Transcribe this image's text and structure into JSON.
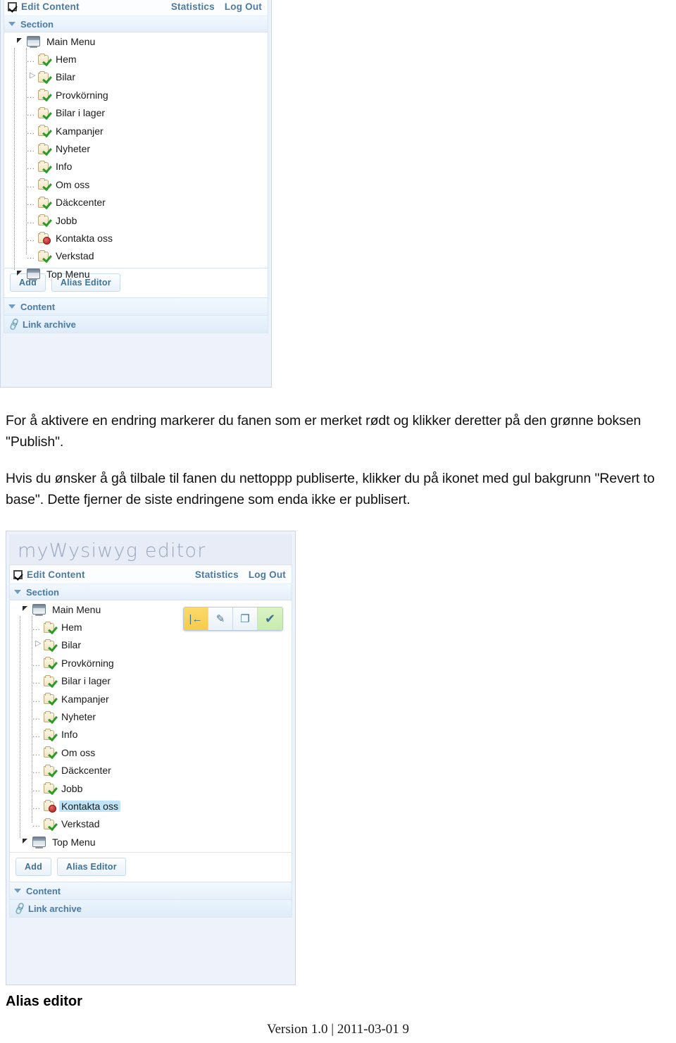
{
  "document": {
    "alias_heading": "Alias editor",
    "footer": "Version 1.0 | 2011-03-01 9"
  },
  "paragraphs": {
    "p1": "For å aktivere en endring markerer du fanen som er merket rødt og klikker deretter på den grønne boksen \"Publish\".",
    "p2": "Hvis du ønsker å gå tilbale til fanen du nettoppp publiserte, klikker du på ikonet med gul bakgrunn \"Revert to base\". Dette fjerner de siste endringene som enda ikke er publisert."
  },
  "cms": {
    "logo": "myWysiwyg editor",
    "menubar": {
      "checkbox_icon": "checked-checkbox-icon",
      "edit_content": "Edit Content",
      "statistics": "Statistics",
      "log_out": "Log Out"
    },
    "section_header": {
      "caret_icon": "chevron-down-icon",
      "label": "Section"
    },
    "tree": [
      {
        "label": "Main Menu",
        "level": 0,
        "icon": "monitor-icon",
        "twig": "arrow-solid",
        "badge": "none",
        "selected": false
      },
      {
        "label": "Hem",
        "level": 1,
        "icon": "page-icon",
        "twig": "dash",
        "badge": "green",
        "selected": false
      },
      {
        "label": "Bilar",
        "level": 1,
        "icon": "page-icon",
        "twig": "arrow-open",
        "badge": "green",
        "selected": false
      },
      {
        "label": "Provkörning",
        "level": 1,
        "icon": "page-icon",
        "twig": "dash",
        "badge": "green",
        "selected": false
      },
      {
        "label": "Bilar i lager",
        "level": 1,
        "icon": "page-icon",
        "twig": "dash",
        "badge": "green",
        "selected": false
      },
      {
        "label": "Kampanjer",
        "level": 1,
        "icon": "page-icon",
        "twig": "dash",
        "badge": "green",
        "selected": false
      },
      {
        "label": "Nyheter",
        "level": 1,
        "icon": "page-icon",
        "twig": "dash",
        "badge": "green",
        "selected": false
      },
      {
        "label": "Info",
        "level": 1,
        "icon": "page-icon",
        "twig": "dash",
        "badge": "green",
        "selected": false
      },
      {
        "label": "Om oss",
        "level": 1,
        "icon": "page-icon",
        "twig": "dash",
        "badge": "green",
        "selected": false
      },
      {
        "label": "Däckcenter",
        "level": 1,
        "icon": "page-icon",
        "twig": "dash",
        "badge": "green",
        "selected": false
      },
      {
        "label": "Jobb",
        "level": 1,
        "icon": "page-icon",
        "twig": "dash",
        "badge": "green",
        "selected": false
      },
      {
        "label": "Kontakta oss",
        "level": 1,
        "icon": "page-icon",
        "twig": "dash",
        "badge": "red",
        "selected": false
      },
      {
        "label": "Verkstad",
        "level": 1,
        "icon": "page-icon",
        "twig": "dash",
        "badge": "green",
        "selected": false
      },
      {
        "label": "Top Menu",
        "level": 0,
        "icon": "monitor-icon",
        "twig": "arrow-solid",
        "badge": "none",
        "selected": false
      }
    ],
    "tree_selected_index": 11,
    "buttons": {
      "add": "Add",
      "alias_editor": "Alias Editor"
    },
    "content_strip": {
      "caret_icon": "chevron-down-icon",
      "label": "Content"
    },
    "link_strip": {
      "link_icon": "link-icon",
      "label": "Link archive"
    },
    "action_toolbar": [
      {
        "name": "revert-to-base-button",
        "glyph": "|←",
        "style": "yellow",
        "title": "Revert to base"
      },
      {
        "name": "edit-button",
        "glyph": "✎",
        "style": "plain",
        "title": "Edit"
      },
      {
        "name": "copy-button",
        "glyph": "❐",
        "style": "plain",
        "title": "Copy"
      },
      {
        "name": "publish-button",
        "glyph": "✔",
        "style": "green",
        "title": "Publish"
      }
    ]
  },
  "colors": {
    "accent_blue": "#4a7aa5",
    "panel_bg": "#eef2fa",
    "selection": "#bfe4f7",
    "revert_yellow": "#f6cd4a",
    "publish_green": "#c8ecaf"
  }
}
